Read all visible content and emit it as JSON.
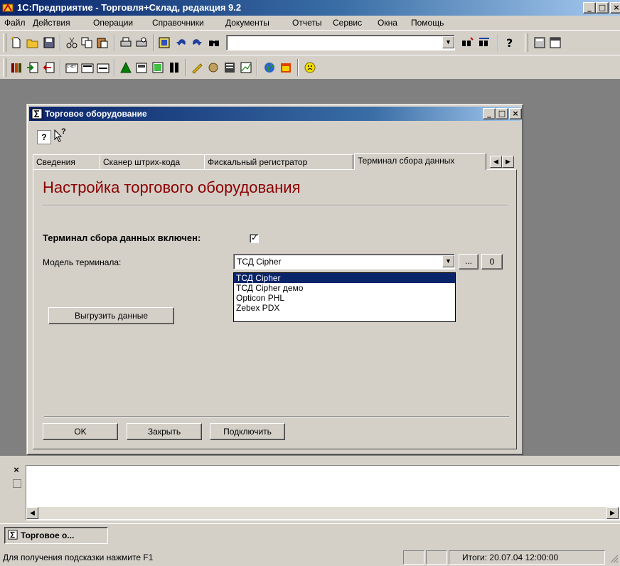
{
  "app": {
    "title": "1С:Предприятие - Торговля+Склад, редакция 9.2",
    "min_glyph": "_",
    "max_glyph": "□",
    "close_glyph": "×"
  },
  "menu": [
    "Файл",
    "Действия",
    "Операции",
    "Справочники",
    "Документы",
    "Отчеты",
    "Сервис",
    "Окна",
    "Помощь"
  ],
  "toolbar1": {
    "icons": [
      "new-doc-icon",
      "open-folder-icon",
      "save-icon",
      "cut-icon",
      "copy-icon",
      "paste-icon",
      "print-icon",
      "print-preview-icon",
      "journal-icon",
      "undo-icon",
      "redo-icon",
      "find-icon",
      "search-combo",
      "find-next-icon",
      "replace-icon",
      "help-icon",
      "calculator-icon",
      "calendar-icon"
    ]
  },
  "toolbar2": {
    "icons": [
      "catalog-icon",
      "import-icon",
      "export-icon",
      "invoice-icon",
      "act-icon",
      "order-icon",
      "bank-icon",
      "cashbox-icon",
      "report-icon",
      "stock-icon",
      "pen-icon",
      "money-icon",
      "ledger-icon",
      "chart-icon",
      "globe-icon",
      "calendar2-icon",
      "smiley-icon"
    ]
  },
  "dialog": {
    "title": "Торговое оборудование",
    "help_glyph": "?",
    "whats_this_glyph": "?",
    "tabs": [
      "Сведения",
      "Сканер штрих-кода",
      "Фискальный регистратор",
      "Терминал сбора данных"
    ],
    "active_tab": "Терминал сбора данных",
    "heading": "Настройка торгового оборудования",
    "enabled_label": "Терминал сбора данных включен:",
    "enabled_checked": true,
    "check_glyph": "✓",
    "model_label": "Модель терминала:",
    "model_value": "ТСД Cipher",
    "model_options": [
      "ТСД Cipher",
      "ТСД Cipher демо",
      "Opticon PHL",
      "Zebex PDX"
    ],
    "browse_label": "...",
    "clear_label": "0",
    "export_button": "Выгрузить данные",
    "ok_button": "OK",
    "close_button": "Закрыть",
    "connect_button": "Подключить"
  },
  "messages": {
    "close_glyph": "×"
  },
  "taskbar": {
    "window_button": "Торговое о..."
  },
  "statusbar": {
    "hint": "Для получения подсказки нажмите F1",
    "totals": "Итоги: 20.07.04 12:00:00"
  }
}
